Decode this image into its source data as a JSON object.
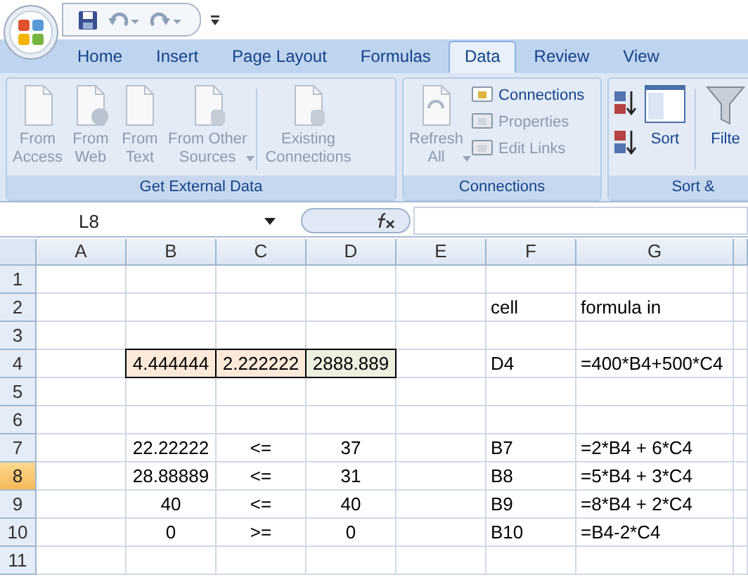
{
  "name_box": {
    "value": "L8"
  },
  "tabs": [
    {
      "label": "Home",
      "selected": false
    },
    {
      "label": "Insert",
      "selected": false
    },
    {
      "label": "Page Layout",
      "selected": false
    },
    {
      "label": "Formulas",
      "selected": false
    },
    {
      "label": "Data",
      "selected": true
    },
    {
      "label": "Review",
      "selected": false
    },
    {
      "label": "View",
      "selected": false
    }
  ],
  "ribbon": {
    "groups": [
      {
        "label": "Get External Data",
        "buttons": [
          {
            "kind": "large",
            "lines": [
              "From",
              "Access"
            ],
            "disabled": true
          },
          {
            "kind": "large",
            "lines": [
              "From",
              "Web"
            ],
            "disabled": true
          },
          {
            "kind": "large",
            "lines": [
              "From",
              "Text"
            ],
            "disabled": true
          },
          {
            "kind": "large",
            "lines": [
              "From Other",
              "Sources"
            ],
            "disabled": true,
            "dropdown": true
          },
          {
            "kind": "large",
            "lines": [
              "Existing",
              "Connections"
            ],
            "disabled": true
          }
        ]
      },
      {
        "label": "Connections",
        "buttons": [
          {
            "kind": "large",
            "lines": [
              "Refresh",
              "All"
            ],
            "disabled": true,
            "dropdown": true
          },
          {
            "kind": "small",
            "lines": [
              "Connections"
            ],
            "disabled": false
          },
          {
            "kind": "small",
            "lines": [
              "Properties"
            ],
            "disabled": true
          },
          {
            "kind": "small",
            "lines": [
              "Edit Links"
            ],
            "disabled": true
          }
        ]
      },
      {
        "label": "Sort &",
        "buttons": [
          {
            "kind": "icon",
            "disabled": false
          },
          {
            "kind": "icon",
            "disabled": false
          },
          {
            "kind": "large",
            "lines": [
              "Sort"
            ],
            "disabled": false
          },
          {
            "kind": "large",
            "lines": [
              "Filte"
            ],
            "disabled": false
          }
        ]
      }
    ]
  },
  "sheet": {
    "columns": [
      "A",
      "B",
      "C",
      "D",
      "E",
      "F",
      "G"
    ],
    "rows": [
      {
        "label": "1",
        "selected": false,
        "cells": [
          "",
          "",
          "",
          "",
          "",
          "",
          ""
        ]
      },
      {
        "label": "2",
        "selected": false,
        "cells": [
          "",
          "",
          "",
          "",
          "",
          "cell",
          "formula in"
        ]
      },
      {
        "label": "3",
        "selected": false,
        "cells": [
          "",
          "",
          "",
          "",
          "",
          "",
          ""
        ]
      },
      {
        "label": "4",
        "selected": false,
        "cells": [
          "",
          {
            "text": "4.444444",
            "color": "#fde9d9"
          },
          {
            "text": "2.222222",
            "color": "#fde9d9"
          },
          {
            "text": "2888.889",
            "color": "#ebf1de"
          },
          "",
          "D4",
          "=400*B4+500*C4"
        ]
      },
      {
        "label": "5",
        "selected": false,
        "cells": [
          "",
          "",
          "",
          "",
          "",
          "",
          ""
        ]
      },
      {
        "label": "6",
        "selected": false,
        "cells": [
          "",
          "",
          "",
          "",
          "",
          "",
          ""
        ]
      },
      {
        "label": "7",
        "selected": false,
        "cells": [
          "",
          "22.22222",
          "<=",
          "37",
          "",
          "B7",
          "=2*B4 + 6*C4"
        ]
      },
      {
        "label": "8",
        "selected": true,
        "cells": [
          "",
          "28.88889",
          "<=",
          "31",
          "",
          "B8",
          "=5*B4 + 3*C4"
        ]
      },
      {
        "label": "9",
        "selected": false,
        "cells": [
          "",
          "40",
          "<=",
          "40",
          "",
          "B9",
          "=8*B4 + 2*C4"
        ]
      },
      {
        "label": "10",
        "selected": false,
        "cells": [
          "",
          "0",
          ">=",
          "0",
          "",
          "B10",
          "=B4-2*C4"
        ]
      },
      {
        "label": "11",
        "selected": false,
        "cells": [
          "",
          "",
          "",
          "",
          "",
          "",
          ""
        ]
      }
    ]
  }
}
